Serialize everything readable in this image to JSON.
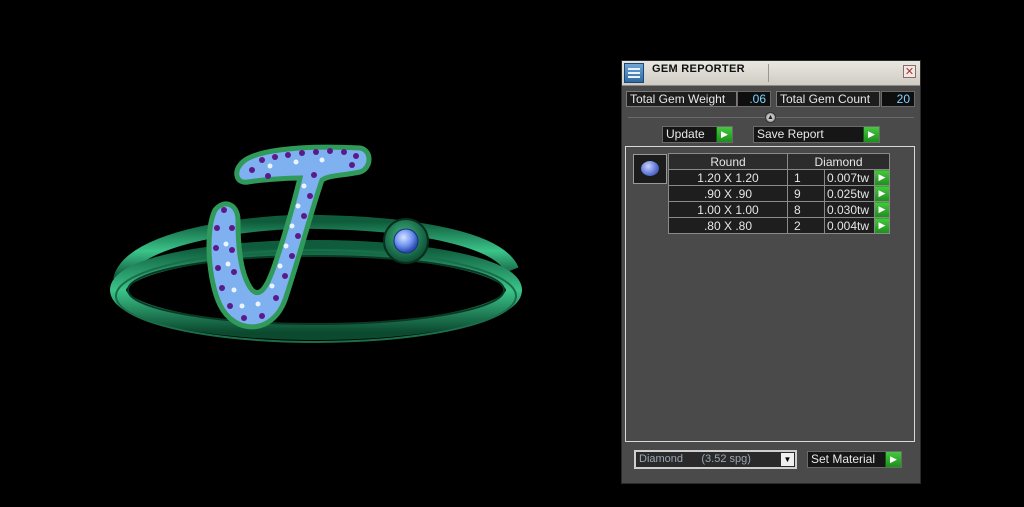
{
  "panel": {
    "title": "GEM REPORTER",
    "close_glyph": "✕",
    "total_gem_weight_label": "Total Gem Weight",
    "total_gem_weight_value": ".06",
    "total_gem_count_label": "Total Gem Count",
    "total_gem_count_value": "20",
    "update_label": "Update",
    "save_report_label": "Save Report",
    "go_glyph": "▶",
    "table": {
      "shape_header": "Round",
      "material_header": "Diamond",
      "rows": [
        {
          "size": "1.20 X 1.20",
          "count": "1",
          "weight": "0.007tw"
        },
        {
          "size": ".90 X .90",
          "count": "9",
          "weight": "0.025tw"
        },
        {
          "size": "1.00 X 1.00",
          "count": "8",
          "weight": "0.030tw"
        },
        {
          "size": ".80 X .80",
          "count": "2",
          "weight": "0.004tw"
        }
      ]
    },
    "material_select_value": "Diamond      (3.52 spg)",
    "set_material_label": "Set Material"
  },
  "icons": {
    "app": "gem-reporter-app-icon",
    "gem": "round-gem-icon",
    "close": "close-icon",
    "go": "green-arrow-icon",
    "dropdown": "chevron-down-icon"
  },
  "colors": {
    "ring_band": "#1f8a5c",
    "stone": "#7fa8ff",
    "accent_green": "#2fb12b",
    "value_text": "#7fd3ff"
  }
}
